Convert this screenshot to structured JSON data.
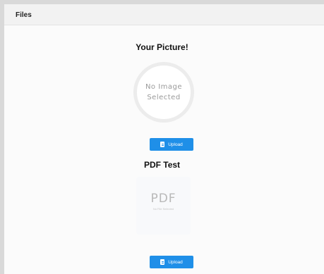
{
  "panel": {
    "title": "Files"
  },
  "picture_section": {
    "title": "Your Picture!",
    "placeholder_line1": "No Image",
    "placeholder_line2": "Selected",
    "upload_label": "Upload",
    "upload_icon": "file-icon"
  },
  "pdf_section": {
    "title": "PDF Test",
    "placeholder_big": "PDF",
    "placeholder_small": "No File Selected",
    "upload_label": "Upload",
    "upload_icon": "file-icon"
  },
  "colors": {
    "accent": "#1f8fe8",
    "border": "#d9d9d9",
    "placeholder_text": "#9a9a9a"
  }
}
